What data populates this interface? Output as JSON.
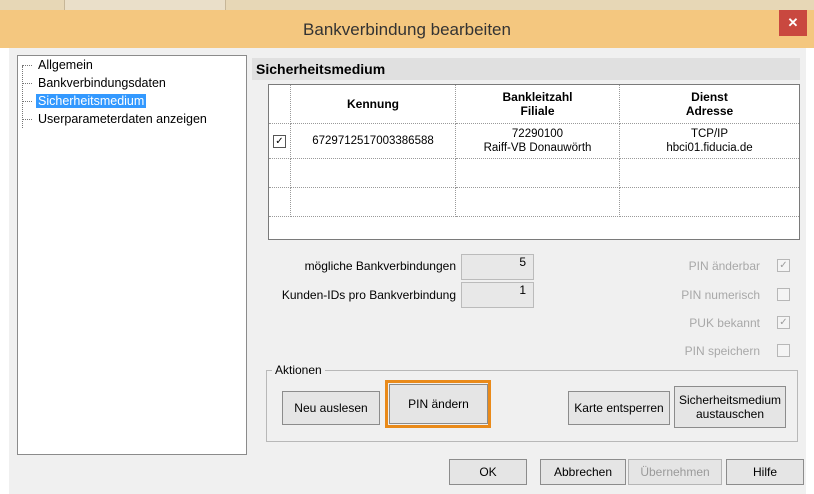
{
  "window": {
    "title": "Bankverbindung bearbeiten",
    "close_glyph": "✕"
  },
  "tree": {
    "items": [
      {
        "label": "Allgemein",
        "selected": false
      },
      {
        "label": "Bankverbindungsdaten",
        "selected": false
      },
      {
        "label": "Sicherheitsmedium",
        "selected": true
      },
      {
        "label": "Userparameterdaten anzeigen",
        "selected": false
      }
    ]
  },
  "section": {
    "title": "Sicherheitsmedium"
  },
  "grid": {
    "headers": {
      "kennung": "Kennung",
      "blz_line1": "Bankleitzahl",
      "blz_line2": "Filiale",
      "dienst_line1": "Dienst",
      "dienst_line2": "Adresse"
    },
    "rows": [
      {
        "checked": "✓",
        "kennung": "6729712517003386588",
        "blz": "72290100",
        "filiale": "Raiff-VB Donauwörth",
        "dienst": "TCP/IP",
        "adresse": "hbci01.fiducia.de"
      }
    ]
  },
  "stats": {
    "moegliche_label": "mögliche Bankverbindungen",
    "moegliche_value": "5",
    "kunden_label": "Kunden-IDs pro Bankverbindung",
    "kunden_value": "1"
  },
  "flags": [
    {
      "label": "PIN änderbar",
      "checked": true,
      "mark": "✓"
    },
    {
      "label": "PIN numerisch",
      "checked": false,
      "mark": ""
    },
    {
      "label": "PUK bekannt",
      "checked": true,
      "mark": "✓"
    },
    {
      "label": "PIN speichern",
      "checked": false,
      "mark": ""
    }
  ],
  "actions": {
    "label": "Aktionen",
    "neu_auslesen": "Neu auslesen",
    "pin_aendern": "PIN ändern",
    "karte_entsperren": "Karte entsperren",
    "sicherheitsmedium_line1": "Sicherheitsmedium",
    "sicherheitsmedium_line2": "austauschen"
  },
  "footer": {
    "ok": "OK",
    "abbrechen": "Abbrechen",
    "uebernehmen": "Übernehmen",
    "hilfe": "Hilfe"
  },
  "colors": {
    "highlight": "#e98a1a",
    "selection": "#3399ff",
    "close": "#c9483f",
    "titlebar": "#f4c77f"
  }
}
